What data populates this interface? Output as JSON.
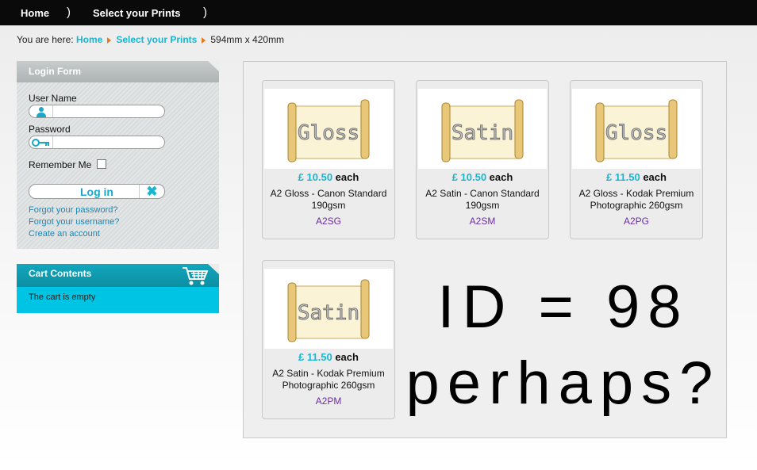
{
  "nav": {
    "home": "Home",
    "sep1": ")",
    "prints": "Select your Prints",
    "sep2": ")"
  },
  "breadcrumb": {
    "prefix": "You are here:",
    "home": "Home",
    "prints": "Select your Prints",
    "current": "594mm x 420mm"
  },
  "login": {
    "title": "Login Form",
    "username_label": "User Name",
    "password_label": "Password",
    "remember_label": "Remember Me",
    "button_label": "Log in",
    "forgot_password": "Forgot your password?",
    "forgot_username": "Forgot your username?",
    "create_account": "Create an account"
  },
  "cart": {
    "title": "Cart Contents",
    "empty": "The cart is empty"
  },
  "products": [
    {
      "image_text": "Gloss",
      "price": "£ 10.50",
      "each": "each",
      "name": "A2 Gloss - Canon Standard 190gsm",
      "code": "A2SG"
    },
    {
      "image_text": "Satin",
      "price": "£ 10.50",
      "each": "each",
      "name": "A2 Satin - Canon Standard 190gsm",
      "code": "A2SM"
    },
    {
      "image_text": "Gloss",
      "price": "£ 11.50",
      "each": "each",
      "name": "A2 Gloss - Kodak Premium Photographic 260gsm",
      "code": "A2PG"
    },
    {
      "image_text": "Satin",
      "price": "£ 11.50",
      "each": "each",
      "name": "A2 Satin - Kodak Premium Photographic 260gsm",
      "code": "A2PM"
    }
  ],
  "overlay": {
    "line1": "ID = 98",
    "line2": "perhaps?"
  },
  "colors": {
    "accent": "#19b6d3",
    "cart_bg": "#00c4e3",
    "code_purple": "#6b2fa0",
    "breadcrumb_arrow": "#e27a1d"
  }
}
